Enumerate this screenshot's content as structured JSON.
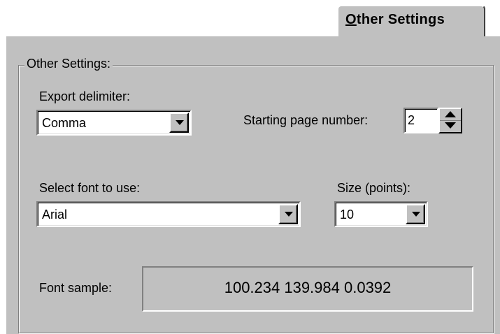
{
  "tab": {
    "accel_char": "O",
    "label_rest": "ther Settings"
  },
  "group": {
    "title": "Other Settings:"
  },
  "export_delimiter": {
    "label": "Export delimiter:",
    "value": "Comma"
  },
  "starting_page": {
    "label": "Starting page number:",
    "value": "2"
  },
  "font": {
    "label": "Select font to use:",
    "value": "Arial"
  },
  "size": {
    "label": "Size (points):",
    "value": "10"
  },
  "sample": {
    "label": "Font sample:",
    "text": "100.234 139.984 0.0392"
  },
  "icons": {
    "dropdown": "chevron-down-icon",
    "spin_up": "arrow-up-icon",
    "spin_down": "arrow-down-icon"
  }
}
